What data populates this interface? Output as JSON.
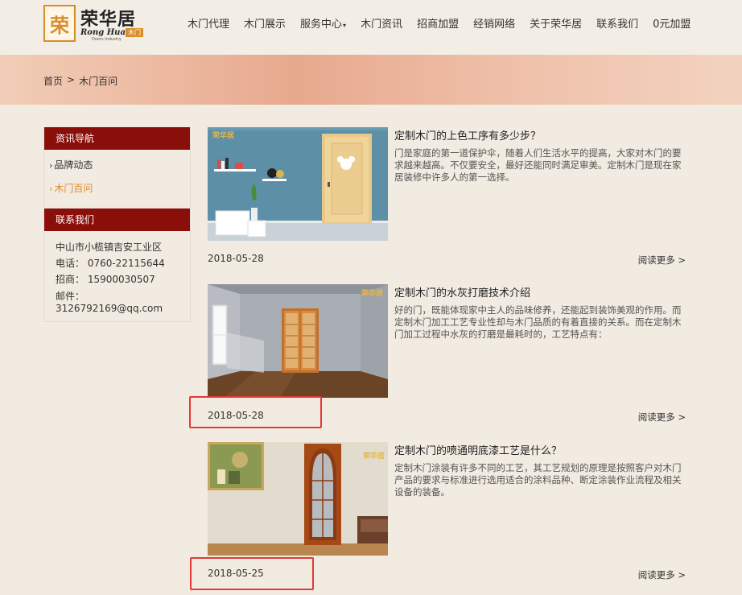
{
  "header": {
    "logo_cn": "荣华居",
    "logo_mark": "荣",
    "logo_en": "Rong Hua Ju",
    "logo_tag": "木门",
    "logo_sub": "Doors Industry",
    "nav": [
      {
        "label": "木门代理"
      },
      {
        "label": "木门展示"
      },
      {
        "label": "服务中心",
        "caret": "▾"
      },
      {
        "label": "木门资讯"
      },
      {
        "label": "招商加盟"
      },
      {
        "label": "经销网络"
      },
      {
        "label": "关于荣华居"
      },
      {
        "label": "联系我们"
      },
      {
        "label": "0元加盟"
      }
    ]
  },
  "breadcrumb": {
    "home": "首页",
    "sep": ">",
    "current": "木门百问"
  },
  "sidebar": {
    "nav_title": "资讯导航",
    "items": [
      {
        "label": "品牌动态",
        "active": false
      },
      {
        "label": "木门百问",
        "active": true
      }
    ],
    "contact_title": "联系我们",
    "contact": {
      "address": "中山市小榄镇吉安工业区",
      "phone": "电话： 0760-22115644",
      "invest": "招商： 15900030507",
      "email_label": "邮件：",
      "email": "3126792169@qq.com"
    }
  },
  "articles": [
    {
      "title": "定制木门的上色工序有多少步？",
      "desc": "门是家庭的第一道保护伞，随着人们生活水平的提高，大家对木门的要求越来越高。不仅要安全，最好还能同时满足审美。定制木门是现在家居装修中许多人的第一选择。",
      "date": "2018-05-28",
      "more": "阅读更多 >",
      "thumb_logo": "荣华居"
    },
    {
      "title": "定制木门的水灰打磨技术介绍",
      "desc": "好的门，既能体现家中主人的品味修养，还能起到装饰美观的作用。而定制木门加工工艺专业性却与木门品质的有着直接的关系。而在定制木门加工过程中水灰的打磨是最耗时的，工艺特点有：",
      "date": "2018-05-28",
      "more": "阅读更多 >",
      "thumb_logo": "荣华居"
    },
    {
      "title": "定制木门的喷通明底漆工艺是什么？",
      "desc": "定制木门涂装有许多不同的工艺，其工艺规划的原理是按照客户对木门产品的要求与标准进行选用适合的涂料品种、断定涂装作业流程及相关设备的装备。",
      "date": "2018-05-25",
      "more": "阅读更多 >",
      "thumb_logo": "荣华居"
    }
  ],
  "colors": {
    "brand_red": "#8a0e0a",
    "accent_orange": "#e08a25",
    "highlight_red": "#e53935"
  }
}
